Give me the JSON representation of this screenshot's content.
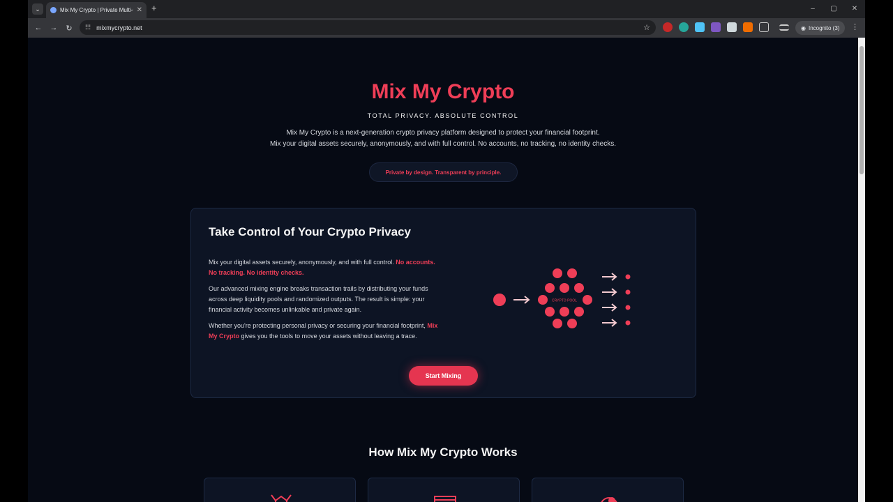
{
  "browser": {
    "tab_title": "Mix My Crypto | Private Multi-C",
    "tab_close": "✕",
    "new_tab": "+",
    "url": "mixmycrypto.net",
    "incognito": "Incognito (3)",
    "window_controls": [
      "–",
      "▢",
      "✕"
    ]
  },
  "hero": {
    "title": "Mix My Crypto",
    "tagline": "TOTAL PRIVACY. ABSOLUTE CONTROL",
    "intro_line1": "Mix My Crypto is a next-generation crypto privacy platform designed to protect your financial footprint.",
    "intro_line2": "Mix your digital assets securely, anonymously, and with full control. No accounts, no tracking, no identity checks.",
    "pill": "Private by design. Transparent by principle."
  },
  "card": {
    "title": "Take Control of Your Crypto Privacy",
    "p1_plain": "Mix your digital assets securely, anonymously, and with full control.",
    "p1_red": "No accounts. No tracking. No identity checks.",
    "p2": "Our advanced mixing engine breaks transaction trails by distributing your funds across deep liquidity pools and randomized outputs. The result is simple: your financial activity becomes unlinkable and private again.",
    "p3_before": "Whether you're protecting personal privacy or securing your financial footprint,",
    "p3_red": "Mix My Crypto",
    "p3_after": "gives you the tools to move your assets without leaving a trace.",
    "pool_label": "CRYPTO POOL",
    "button": "Start Mixing"
  },
  "how": {
    "title": "How Mix My Crypto Works"
  },
  "colors": {
    "accent": "#ef3e57",
    "background": "#060a14",
    "card": "#0d1424"
  }
}
